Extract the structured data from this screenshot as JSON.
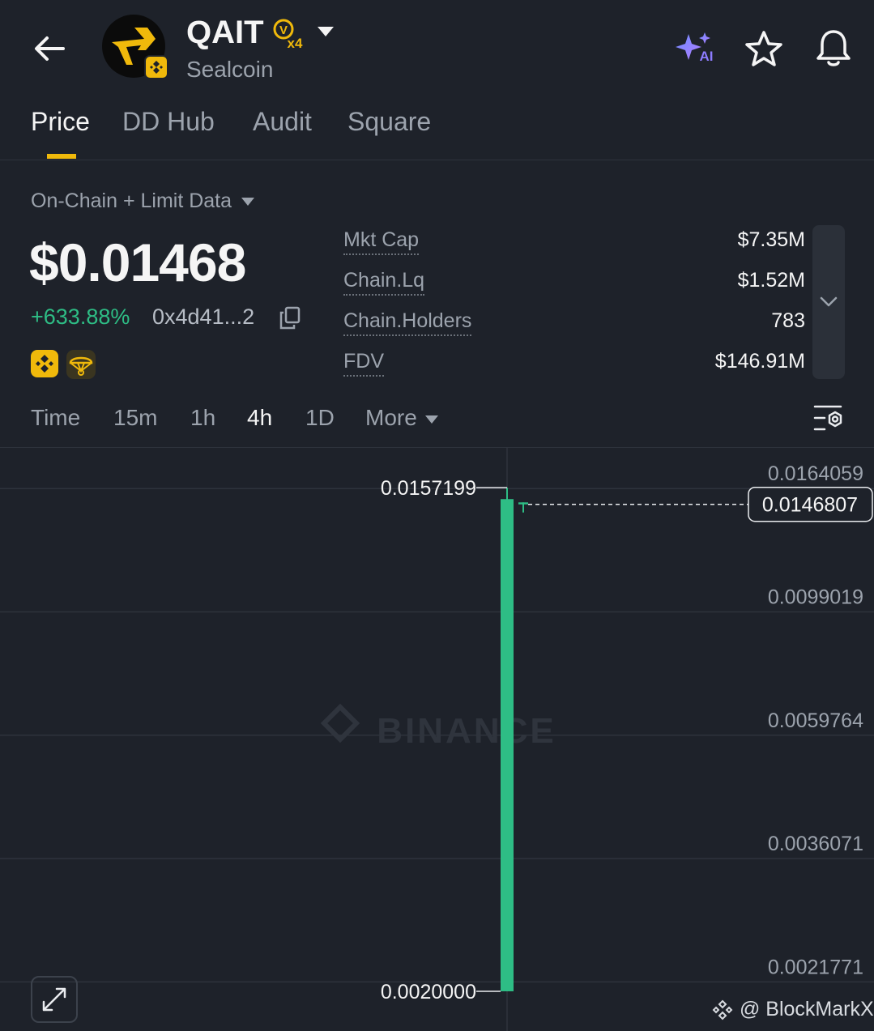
{
  "header": {
    "ticker": "QAIT",
    "tag_badge": "x4",
    "tag_letter": "V",
    "project_name": "Sealcoin",
    "ai_label": "AI"
  },
  "tabs": [
    {
      "label": "Price",
      "active": true
    },
    {
      "label": "DD Hub",
      "active": false
    },
    {
      "label": "Audit",
      "active": false
    },
    {
      "label": "Square",
      "active": false
    }
  ],
  "price_panel": {
    "data_source": "On-Chain + Limit Data",
    "price": "$0.01468",
    "change": "+633.88%",
    "address": "0x4d41...2"
  },
  "stats": [
    {
      "label": "Mkt Cap",
      "value": "$7.35M"
    },
    {
      "label": "Chain.Lq",
      "value": "$1.52M"
    },
    {
      "label": "Chain.Holders",
      "value": "783"
    },
    {
      "label": "FDV",
      "value": "$146.91M"
    }
  ],
  "timeframes": [
    {
      "label": "Time",
      "active": false
    },
    {
      "label": "15m",
      "active": false
    },
    {
      "label": "1h",
      "active": false
    },
    {
      "label": "4h",
      "active": true
    },
    {
      "label": "1D",
      "active": false
    },
    {
      "label": "More",
      "active": false
    }
  ],
  "chart_data": {
    "type": "candlestick",
    "y_scale": "log",
    "ylim": [
      0.0017,
      0.0185
    ],
    "y_ticks": [
      "0.0164059",
      "0.0099019",
      "0.0059764",
      "0.0036071",
      "0.0021771"
    ],
    "y_tick_values": [
      0.0164059,
      0.0099019,
      0.0059764,
      0.0036071,
      0.0021771
    ],
    "candles": [
      {
        "open": 0.002,
        "high": 0.0157199,
        "low": 0.002,
        "close": 0.015
      },
      {
        "open": 0.0148,
        "high": 0.0148,
        "low": 0.0142,
        "close": 0.0146807
      }
    ],
    "high_label": "0.0157199",
    "low_label": "0.0020000",
    "last_price_label": "0.0146807",
    "last_price": 0.0146807,
    "watermark": "BINANCE",
    "colors": {
      "up": "#2ebd85",
      "grid": "#2e333c",
      "text": "#9ca3ad"
    }
  },
  "footer": {
    "credit": "@ BlockMarkX"
  }
}
